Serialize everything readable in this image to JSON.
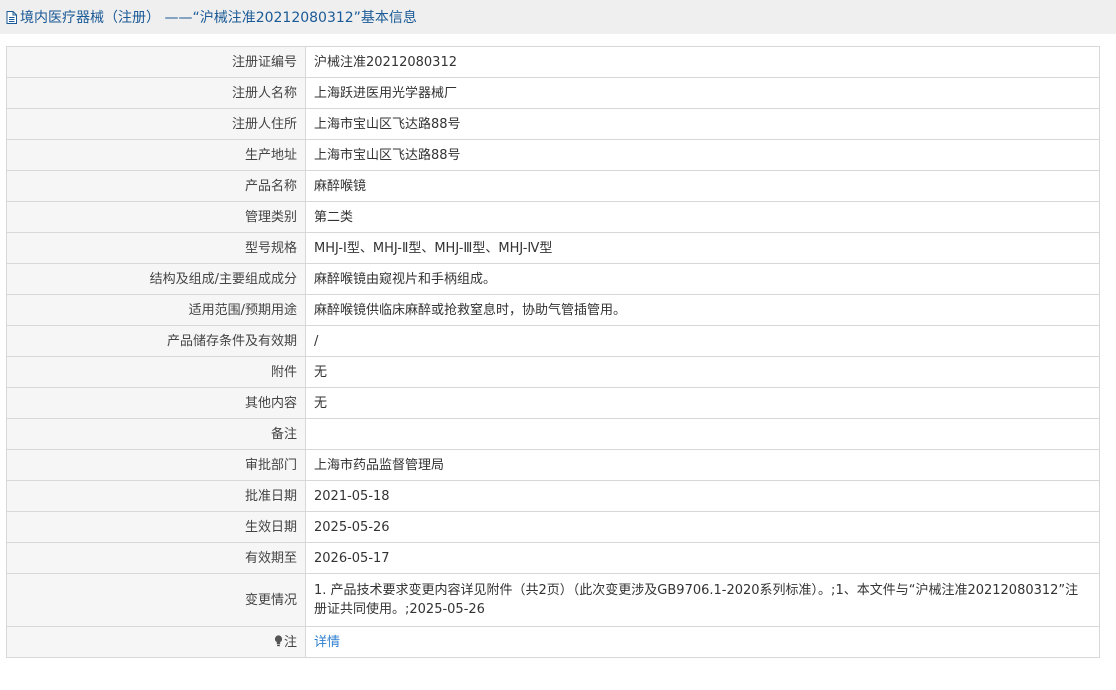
{
  "header": {
    "icon": "document-icon",
    "title": "境内医疗器械（注册） ——“沪械注准20212080312”基本信息"
  },
  "rows": [
    {
      "label": "注册证编号",
      "value": "沪械注准20212080312"
    },
    {
      "label": "注册人名称",
      "value": "上海跃进医用光学器械厂"
    },
    {
      "label": "注册人住所",
      "value": "上海市宝山区飞达路88号"
    },
    {
      "label": "生产地址",
      "value": "上海市宝山区飞达路88号"
    },
    {
      "label": "产品名称",
      "value": "麻醉喉镜"
    },
    {
      "label": "管理类别",
      "value": "第二类"
    },
    {
      "label": "型号规格",
      "value": "MHJ-Ⅰ型、MHJ-Ⅱ型、MHJ-Ⅲ型、MHJ-Ⅳ型"
    },
    {
      "label": "结构及组成/主要组成成分",
      "value": "麻醉喉镜由窥视片和手柄组成。"
    },
    {
      "label": "适用范围/预期用途",
      "value": "麻醉喉镜供临床麻醉或抢救窒息时，协助气管插管用。"
    },
    {
      "label": "产品储存条件及有效期",
      "value": "/"
    },
    {
      "label": "附件",
      "value": "无"
    },
    {
      "label": "其他内容",
      "value": "无"
    },
    {
      "label": "备注",
      "value": ""
    },
    {
      "label": "审批部门",
      "value": "上海市药品监督管理局"
    },
    {
      "label": "批准日期",
      "value": "2021-05-18"
    },
    {
      "label": "生效日期",
      "value": "2025-05-26"
    },
    {
      "label": "有效期至",
      "value": "2026-05-17"
    },
    {
      "label": "变更情况",
      "value": "1. 产品技术要求变更内容详见附件（共2页）（此次变更涉及GB9706.1-2020系列标准）。;1、本文件与“沪械注准20212080312”注册证共同使用。;2025-05-26"
    }
  ],
  "note": {
    "icon": "lightbulb-icon",
    "label": "注",
    "link_text": "详情"
  },
  "colors": {
    "title": "#1a5a96",
    "link": "#2f7fd0",
    "label_bg": "#f6f6f6",
    "border": "#d8d8d8"
  }
}
